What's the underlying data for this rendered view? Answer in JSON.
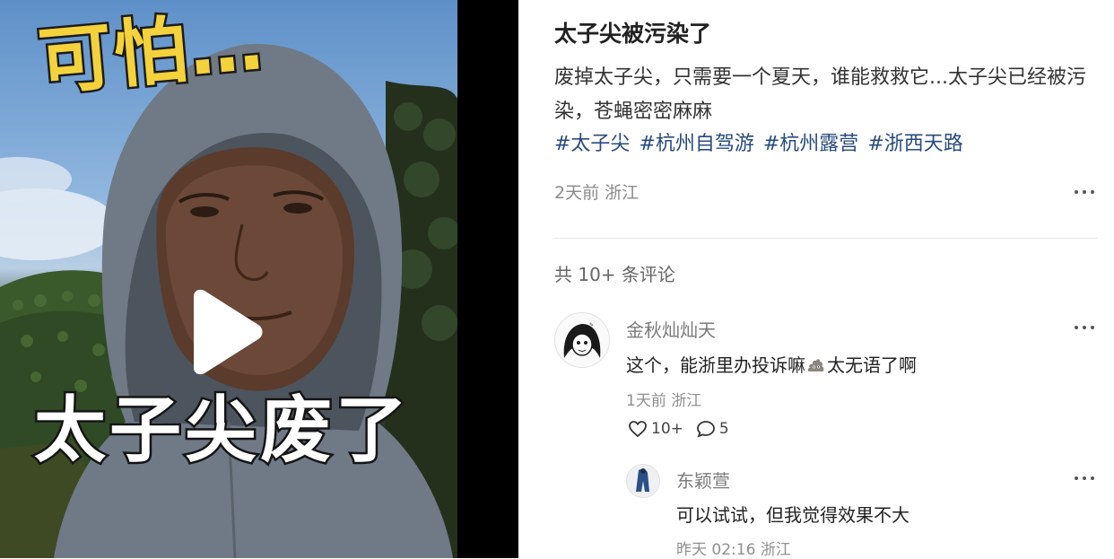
{
  "video": {
    "overlay_top": "可怕…",
    "overlay_bottom": "太子尖废了"
  },
  "post": {
    "title": "太子尖被污染了",
    "body": "废掉太子尖，只需要一个夏天，谁能救救它...太子尖已经被污染，苍蝇密密麻麻",
    "tags": [
      "#太子尖",
      "#杭州自驾游",
      "#杭州露营",
      "#浙西天路"
    ],
    "meta": "2天前 浙江"
  },
  "comments": {
    "count_label": "共 10+ 条评论",
    "items": [
      {
        "name": "金秋灿灿天",
        "text_before": "这个，能浙里办投诉嘛",
        "emoji": "poop-emoji",
        "text_after": "太无语了啊",
        "meta": "1天前 浙江",
        "likes": "10+",
        "replies": "5"
      },
      {
        "name": "东颖萱",
        "text": "可以试试，但我觉得效果不大",
        "meta": "昨天 02:16 浙江"
      }
    ]
  },
  "colors": {
    "tag": "#274a7c",
    "overlay_yellow": "#f3d23c",
    "meta_gray": "#8a8a8a"
  }
}
